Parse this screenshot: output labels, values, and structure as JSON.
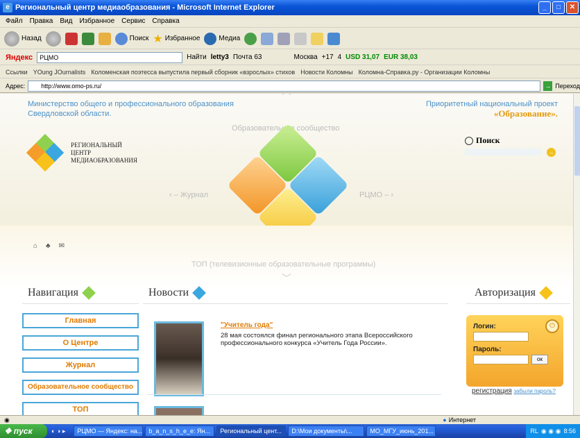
{
  "window": {
    "title": "Региональный центр медиаобразования - Microsoft Internet Explorer",
    "controls": {
      "minimize": "_",
      "maximize": "□",
      "close": "✕"
    }
  },
  "menu": [
    "Файл",
    "Правка",
    "Вид",
    "Избранное",
    "Сервис",
    "Справка"
  ],
  "toolbar": {
    "back": "Назад",
    "search": "Поиск",
    "favorites": "Избранное",
    "media": "Медиа"
  },
  "yandex_bar": {
    "brand": "Яндекс",
    "query": "РЦМО",
    "find": "Найти",
    "user": "letty3",
    "mail": "Почта 63",
    "city": "Москва",
    "temp": "+17",
    "count": "4",
    "usd": "USD 31,07",
    "eur": "EUR 38,03"
  },
  "links_bar": {
    "label": "Ссылки",
    "items": [
      "YOung JOurnalists",
      "Коломенская поэтесса выпустила первый сборник «взрослых» стихов",
      "Новости Коломны",
      "Коломна-Справка.ру - Организации Коломны"
    ]
  },
  "address_bar": {
    "label": "Адрес:",
    "url": "http://www.omo-ps.ru/",
    "go": "Переход"
  },
  "page": {
    "ministry": "Министерство общего и профессионального образования Свердловской области.",
    "national_project": "Приоритетный национальный проект",
    "national_project_name": "«Образование».",
    "logo_lines": [
      "РЕГИОНАЛЬНЫЙ",
      "ЦЕНТР",
      "МЕДИАОБРАЗОВАНИЯ"
    ],
    "nav_top": "Образовательное сообщество",
    "nav_left": "Журнал",
    "nav_right": "РЦМО",
    "nav_bottom": "ТОП (телевизионные образовательные программы)",
    "search_title": "Поиск"
  },
  "sections": {
    "navigation": "Навигация",
    "news": "Новости",
    "auth": "Авторизация"
  },
  "nav_items": [
    "Главная",
    "О Центре",
    "Журнал",
    "Образовательное сообщество",
    "ТОП"
  ],
  "news": [
    {
      "headline": "\"Учитель года\"",
      "body": "28 мая состоялся финал регионального этапа Всероссийского профессионального конкурса «Учитель Года России»."
    }
  ],
  "auth": {
    "login_label": "Логин:",
    "password_label": "Пароль:",
    "ok": "ок",
    "register": "регистрация",
    "forgot": "забыли пароль?"
  },
  "status": {
    "zone": "Интернет"
  },
  "taskbar": {
    "start": "пуск",
    "tasks": [
      "РЦМО — Яндекс: на...",
      "b_a_n_s_h_e_e: Ян...",
      "Региональный цент...",
      "D:\\Мои документы\\...",
      "МО_МГУ_июнь_201..."
    ],
    "tray_lang": "RL",
    "time": "8:56"
  },
  "colors": {
    "accent_orange": "#e07b00",
    "accent_blue": "#4aa6d8",
    "diamond_green": "#8fd14f",
    "diamond_blue": "#3aa7e0",
    "diamond_yellow": "#f7c21a",
    "diamond_orange": "#f59d2a"
  }
}
